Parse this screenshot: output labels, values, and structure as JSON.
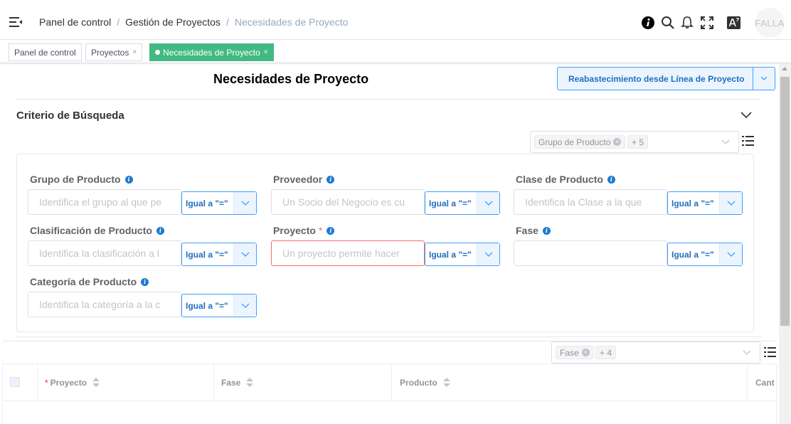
{
  "breadcrumb": {
    "home": "Panel de control",
    "parent": "Gestión de Proyectos",
    "current": "Necesidades de Proyecto"
  },
  "header_icons": [
    "info-icon",
    "search-icon",
    "bell-icon",
    "fullscreen-icon",
    "language-icon"
  ],
  "user": {
    "avatar_text": "FALLA"
  },
  "tags": [
    {
      "label": "Panel de control",
      "closable": false,
      "active": false
    },
    {
      "label": "Proyectos",
      "closable": true,
      "active": false
    },
    {
      "label": "Necesidades de Proyecto",
      "closable": true,
      "active": true
    }
  ],
  "tag_close": "×",
  "page": {
    "title": "Necesidades de Proyecto",
    "action_button": "Reabastecimiento desde Línea de Proyecto"
  },
  "search": {
    "title": "Criterio de Búsqueda",
    "column_chip": "Grupo de Producto",
    "column_more": "+ 5",
    "fields": [
      {
        "label": "Grupo de Producto",
        "required": false,
        "placeholder": "Identifica el grupo al que pe",
        "operator": "Igual a \"=\""
      },
      {
        "label": "Proveedor",
        "required": false,
        "placeholder": "Un Socio del Negocio es cu",
        "operator": "Igual a \"=\""
      },
      {
        "label": "Clase de Producto",
        "required": false,
        "placeholder": "Identifica la Clase a la que",
        "operator": "Igual a \"=\""
      },
      {
        "label": "Clasificación de Producto",
        "required": false,
        "placeholder": "Identifica la clasificación a l",
        "operator": "Igual a \"=\""
      },
      {
        "label": "Proyecto",
        "required": true,
        "placeholder": "Un proyecto permite hacer",
        "operator": "Igual a \"=\""
      },
      {
        "label": "Fase",
        "required": false,
        "placeholder": "",
        "operator": "Igual a \"=\""
      },
      {
        "label": "Categoría de Producto",
        "required": false,
        "placeholder": "Identifica la categoría a la c",
        "operator": "Igual a \"=\""
      }
    ],
    "required_mark": "*"
  },
  "table": {
    "column_chip": "Fase",
    "column_more": "+ 4",
    "columns": [
      {
        "label": "Proyecto",
        "required": true
      },
      {
        "label": "Fase",
        "required": false
      },
      {
        "label": "Producto",
        "required": false
      },
      {
        "label": "Cant",
        "required": false
      }
    ]
  },
  "colors": {
    "accent": "#409eff",
    "active_tag": "#42b983",
    "required": "#f56c6c"
  }
}
